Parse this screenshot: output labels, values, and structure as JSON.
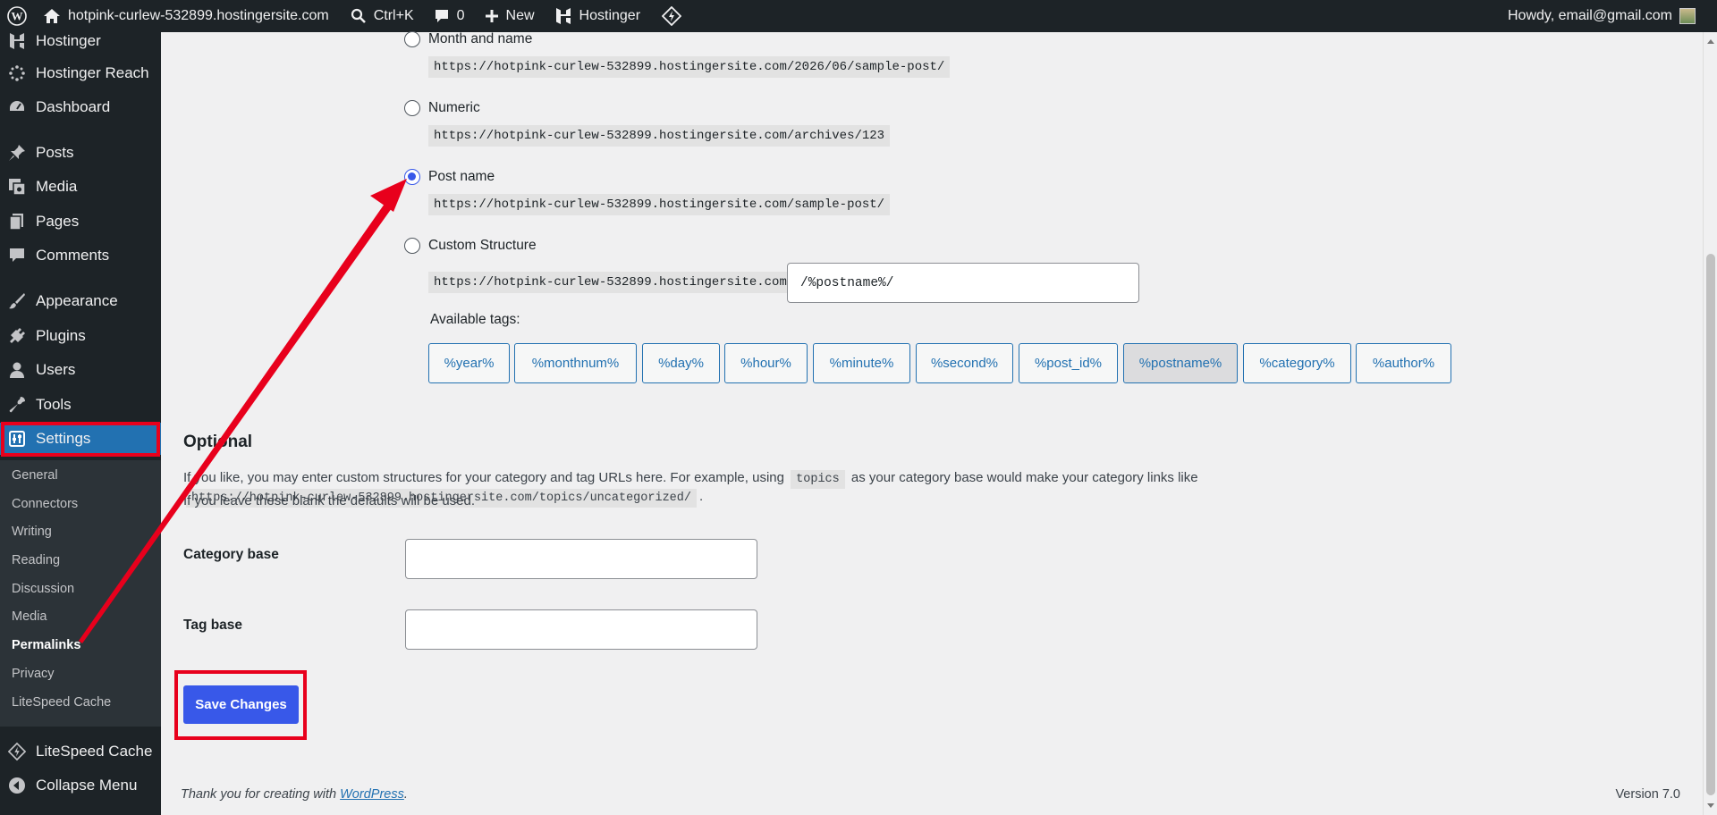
{
  "admin_bar": {
    "site_name": "hotpink-curlew-532899.hostingersite.com",
    "search_shortcut": "Ctrl+K",
    "comments_count": "0",
    "new_label": "New",
    "hostinger_label": "Hostinger",
    "greeting": "Howdy, email@gmail.com"
  },
  "sidebar": {
    "items": [
      {
        "label": "Hostinger",
        "icon": "hostinger-icon"
      },
      {
        "label": "Hostinger Reach",
        "icon": "reach-icon"
      },
      {
        "label": "Dashboard",
        "icon": "dashboard-icon"
      },
      {
        "label": "Posts",
        "icon": "pin-icon"
      },
      {
        "label": "Media",
        "icon": "media-icon"
      },
      {
        "label": "Pages",
        "icon": "pages-icon"
      },
      {
        "label": "Comments",
        "icon": "comment-icon"
      },
      {
        "label": "Appearance",
        "icon": "brush-icon"
      },
      {
        "label": "Plugins",
        "icon": "plug-icon"
      },
      {
        "label": "Users",
        "icon": "user-icon"
      },
      {
        "label": "Tools",
        "icon": "wrench-icon"
      },
      {
        "label": "Settings",
        "icon": "settings-icon"
      }
    ],
    "submenu": [
      "General",
      "Connectors",
      "Writing",
      "Reading",
      "Discussion",
      "Media",
      "Permalinks",
      "Privacy",
      "LiteSpeed Cache"
    ],
    "litespeed_label": "LiteSpeed Cache",
    "collapse_label": "Collapse Menu"
  },
  "permalinks": {
    "options": [
      {
        "label": "Month and name",
        "example": "https://hotpink-curlew-532899.hostingersite.com/2026/06/sample-post/",
        "checked": false
      },
      {
        "label": "Numeric",
        "example": "https://hotpink-curlew-532899.hostingersite.com/archives/123",
        "checked": false
      },
      {
        "label": "Post name",
        "example": "https://hotpink-curlew-532899.hostingersite.com/sample-post/",
        "checked": true
      },
      {
        "label": "Custom Structure",
        "checked": false
      }
    ],
    "custom_base": "https://hotpink-curlew-532899.hostingersite.com",
    "custom_value": "/%postname%/",
    "available_tags_label": "Available tags:",
    "tags": [
      "%year%",
      "%monthnum%",
      "%day%",
      "%hour%",
      "%minute%",
      "%second%",
      "%post_id%",
      "%postname%",
      "%category%",
      "%author%"
    ],
    "pressed_tag": "%postname%"
  },
  "optional": {
    "title": "Optional",
    "desc_part1": "If you like, you may enter custom structures for your category and tag URLs here. For example, using",
    "desc_code1": "topics",
    "desc_part2": "as your category base would make your category links like",
    "desc_code2": "https://hotpink-curlew-532899.hostingersite.com/topics/uncategorized/",
    "desc_part3": ".",
    "desc_line2": "If you leave these blank the defaults will be used.",
    "category_base_label": "Category base",
    "category_base_value": "",
    "tag_base_label": "Tag base",
    "tag_base_value": ""
  },
  "save_label": "Save Changes",
  "footer": {
    "thanks_prefix": "Thank you for creating with",
    "wordpress_link": "WordPress",
    "thanks_suffix": ".",
    "version": "Version 7.0"
  },
  "colors": {
    "accent": "#3858e9",
    "highlight_red": "#e8001c",
    "admin_dark": "#1d2327"
  }
}
